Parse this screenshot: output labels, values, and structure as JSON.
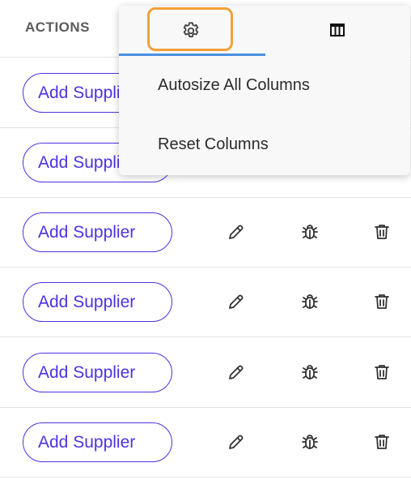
{
  "header": {
    "label": "ACTIONS"
  },
  "rows": [
    {
      "button_label": "Add Supplier"
    },
    {
      "button_label": "Add Supplier"
    },
    {
      "button_label": "Add Supplier"
    },
    {
      "button_label": "Add Supplier"
    },
    {
      "button_label": "Add Supplier"
    },
    {
      "button_label": "Add Supplier"
    }
  ],
  "row_icons": [
    "pencil-icon",
    "bug-icon",
    "trash-icon"
  ],
  "popup": {
    "tabs": [
      "gear-icon",
      "columns-icon"
    ],
    "active_tab": "gear-icon",
    "menu": [
      "Autosize All Columns",
      "Reset Columns"
    ]
  },
  "colors": {
    "accent": "#4b34e0",
    "tab_underline": "#4a90e2",
    "focus_ring": "#f2a03a"
  }
}
